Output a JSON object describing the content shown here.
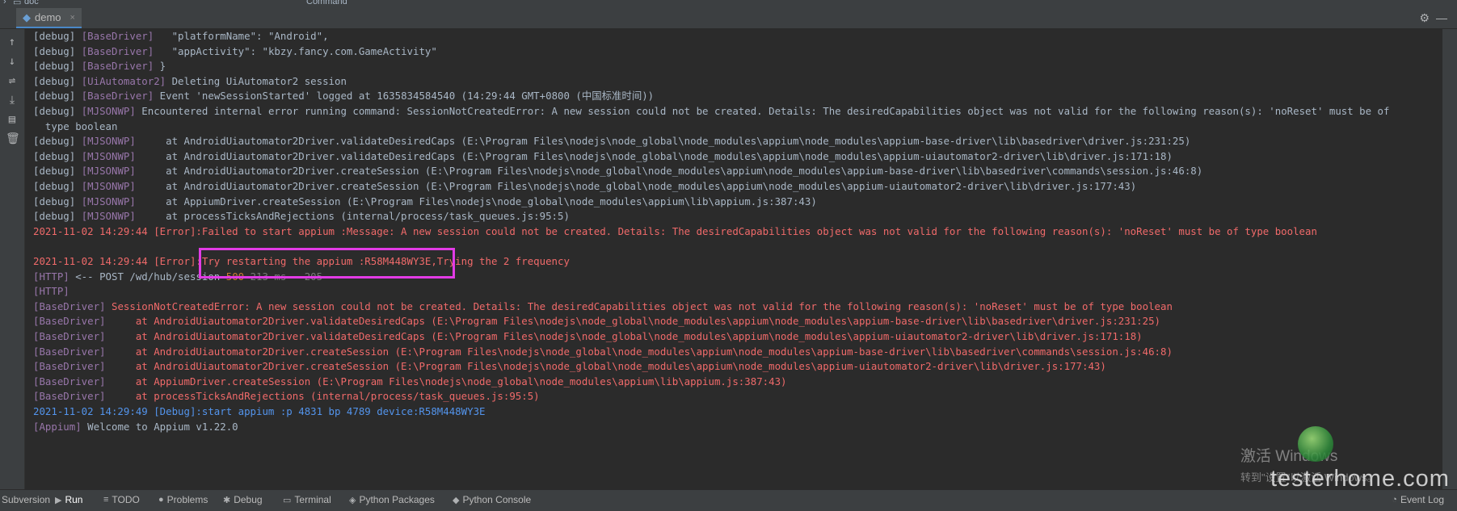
{
  "top_strip": {
    "project": "doc",
    "command": "Command"
  },
  "run_tab": {
    "label": "demo",
    "close": "×"
  },
  "console_lines": [
    {
      "segs": [
        {
          "c": "dbg",
          "t": "[debug] "
        },
        {
          "c": "cls",
          "t": "[BaseDriver]"
        },
        {
          "c": "dbg",
          "t": "   \"platformName\": \"Android\","
        }
      ]
    },
    {
      "segs": [
        {
          "c": "dbg",
          "t": "[debug] "
        },
        {
          "c": "cls",
          "t": "[BaseDriver]"
        },
        {
          "c": "dbg",
          "t": "   \"appActivity\": \"kbzy.fancy.com.GameActivity\""
        }
      ]
    },
    {
      "segs": [
        {
          "c": "dbg",
          "t": "[debug] "
        },
        {
          "c": "cls",
          "t": "[BaseDriver]"
        },
        {
          "c": "dbg",
          "t": " }"
        }
      ]
    },
    {
      "segs": [
        {
          "c": "dbg",
          "t": "[debug] "
        },
        {
          "c": "cls",
          "t": "[UiAutomator2]"
        },
        {
          "c": "dbg",
          "t": " Deleting UiAutomator2 session"
        }
      ]
    },
    {
      "segs": [
        {
          "c": "dbg",
          "t": "[debug] "
        },
        {
          "c": "cls",
          "t": "[BaseDriver]"
        },
        {
          "c": "dbg",
          "t": " Event 'newSessionStarted' logged at 1635834584540 (14:29:44 GMT+0800 (中国标准时间))"
        }
      ]
    },
    {
      "segs": [
        {
          "c": "dbg",
          "t": "[debug] "
        },
        {
          "c": "cls",
          "t": "[MJSONWP]"
        },
        {
          "c": "dbg",
          "t": " Encountered internal error running command: SessionNotCreatedError: A new session could not be created. Details: The desiredCapabilities object was not valid for the following reason(s): 'noReset' must be of"
        }
      ]
    },
    {
      "segs": [
        {
          "c": "dbg",
          "t": "  type boolean"
        }
      ]
    },
    {
      "segs": [
        {
          "c": "dbg",
          "t": "[debug] "
        },
        {
          "c": "cls",
          "t": "[MJSONWP]"
        },
        {
          "c": "dbg",
          "t": "     at AndroidUiautomator2Driver.validateDesiredCaps (E:\\Program Files\\nodejs\\node_global\\node_modules\\appium\\node_modules\\appium-base-driver\\lib\\basedriver\\driver.js:231:25)"
        }
      ]
    },
    {
      "segs": [
        {
          "c": "dbg",
          "t": "[debug] "
        },
        {
          "c": "cls",
          "t": "[MJSONWP]"
        },
        {
          "c": "dbg",
          "t": "     at AndroidUiautomator2Driver.validateDesiredCaps (E:\\Program Files\\nodejs\\node_global\\node_modules\\appium\\node_modules\\appium-uiautomator2-driver\\lib\\driver.js:171:18)"
        }
      ]
    },
    {
      "segs": [
        {
          "c": "dbg",
          "t": "[debug] "
        },
        {
          "c": "cls",
          "t": "[MJSONWP]"
        },
        {
          "c": "dbg",
          "t": "     at AndroidUiautomator2Driver.createSession (E:\\Program Files\\nodejs\\node_global\\node_modules\\appium\\node_modules\\appium-base-driver\\lib\\basedriver\\commands\\session.js:46:8)"
        }
      ]
    },
    {
      "segs": [
        {
          "c": "dbg",
          "t": "[debug] "
        },
        {
          "c": "cls",
          "t": "[MJSONWP]"
        },
        {
          "c": "dbg",
          "t": "     at AndroidUiautomator2Driver.createSession (E:\\Program Files\\nodejs\\node_global\\node_modules\\appium\\node_modules\\appium-uiautomator2-driver\\lib\\driver.js:177:43)"
        }
      ]
    },
    {
      "segs": [
        {
          "c": "dbg",
          "t": "[debug] "
        },
        {
          "c": "cls",
          "t": "[MJSONWP]"
        },
        {
          "c": "dbg",
          "t": "     at AppiumDriver.createSession (E:\\Program Files\\nodejs\\node_global\\node_modules\\appium\\lib\\appium.js:387:43)"
        }
      ]
    },
    {
      "segs": [
        {
          "c": "dbg",
          "t": "[debug] "
        },
        {
          "c": "cls",
          "t": "[MJSONWP]"
        },
        {
          "c": "dbg",
          "t": "     at processTicksAndRejections (internal/process/task_queues.js:95:5)"
        }
      ]
    },
    {
      "segs": [
        {
          "c": "redt",
          "t": "2021-11-02 14:29:44 [Error]:Failed to start appium :Message: A new session could not be created. Details: The desiredCapabilities object was not valid for the following reason(s): 'noReset' must be of type boolean"
        }
      ]
    },
    {
      "segs": [
        {
          "c": "dbg",
          "t": ""
        }
      ]
    },
    {
      "segs": [
        {
          "c": "redt",
          "t": "2021-11-02 14:29:44 [Error]:Try restarting the appium :R58M448WY3E,Trying the 2 frequency"
        }
      ]
    },
    {
      "segs": [
        {
          "c": "cls",
          "t": "[HTTP]"
        },
        {
          "c": "http",
          "t": " <-- POST /wd/hub/session "
        },
        {
          "c": "code",
          "t": "500"
        },
        {
          "c": "gray",
          "t": " 213 ms - 205"
        }
      ]
    },
    {
      "segs": [
        {
          "c": "cls",
          "t": "[HTTP]"
        }
      ]
    },
    {
      "segs": [
        {
          "c": "cls",
          "t": "[BaseDriver]"
        },
        {
          "c": "redt",
          "t": " SessionNotCreatedError: A new session could not be created. Details: The desiredCapabilities object was not valid for the following reason(s): 'noReset' must be of type boolean"
        }
      ]
    },
    {
      "segs": [
        {
          "c": "cls",
          "t": "[BaseDriver]"
        },
        {
          "c": "redt",
          "t": "     at AndroidUiautomator2Driver.validateDesiredCaps (E:\\Program Files\\nodejs\\node_global\\node_modules\\appium\\node_modules\\appium-base-driver\\lib\\basedriver\\driver.js:231:25)"
        }
      ]
    },
    {
      "segs": [
        {
          "c": "cls",
          "t": "[BaseDriver]"
        },
        {
          "c": "redt",
          "t": "     at AndroidUiautomator2Driver.validateDesiredCaps (E:\\Program Files\\nodejs\\node_global\\node_modules\\appium\\node_modules\\appium-uiautomator2-driver\\lib\\driver.js:171:18)"
        }
      ]
    },
    {
      "segs": [
        {
          "c": "cls",
          "t": "[BaseDriver]"
        },
        {
          "c": "redt",
          "t": "     at AndroidUiautomator2Driver.createSession (E:\\Program Files\\nodejs\\node_global\\node_modules\\appium\\node_modules\\appium-base-driver\\lib\\basedriver\\commands\\session.js:46:8)"
        }
      ]
    },
    {
      "segs": [
        {
          "c": "cls",
          "t": "[BaseDriver]"
        },
        {
          "c": "redt",
          "t": "     at AndroidUiautomator2Driver.createSession (E:\\Program Files\\nodejs\\node_global\\node_modules\\appium\\node_modules\\appium-uiautomator2-driver\\lib\\driver.js:177:43)"
        }
      ]
    },
    {
      "segs": [
        {
          "c": "cls",
          "t": "[BaseDriver]"
        },
        {
          "c": "redt",
          "t": "     at AppiumDriver.createSession (E:\\Program Files\\nodejs\\node_global\\node_modules\\appium\\lib\\appium.js:387:43)"
        }
      ]
    },
    {
      "segs": [
        {
          "c": "cls",
          "t": "[BaseDriver]"
        },
        {
          "c": "redt",
          "t": "     at processTicksAndRejections (internal/process/task_queues.js:95:5)"
        }
      ]
    },
    {
      "segs": [
        {
          "c": "blue",
          "t": "2021-11-02 14:29:49 [Debug]:start appium :p 4831 bp 4789 device:R58M448WY3E"
        }
      ]
    },
    {
      "segs": [
        {
          "c": "cls",
          "t": "[Appium]"
        },
        {
          "c": "dbg",
          "t": " Welcome to Appium v1.22.0"
        }
      ]
    }
  ],
  "bottom_tabs": [
    {
      "icon": "",
      "label": "Subversion"
    },
    {
      "icon": "▶",
      "label": "Run"
    },
    {
      "icon": "≡",
      "label": "TODO"
    },
    {
      "icon": "●",
      "label": "Problems"
    },
    {
      "icon": "✱",
      "label": "Debug"
    },
    {
      "icon": "▭",
      "label": "Terminal"
    },
    {
      "icon": "◈",
      "label": "Python Packages"
    },
    {
      "icon": "◆",
      "label": "Python Console"
    }
  ],
  "event_log": "Event Log",
  "watermark": {
    "activate_title": "激活 Windows",
    "activate_sub": "转到\"设置\"以激活 Windows。",
    "site": "testerhome.com"
  },
  "colors": {
    "background": "#2b2b2b",
    "panel": "#3c3f41",
    "highlight_box": "#e23be5",
    "error_text": "#f06a6a",
    "class_tag": "#9876aa",
    "debug_blue": "#5394ec"
  }
}
